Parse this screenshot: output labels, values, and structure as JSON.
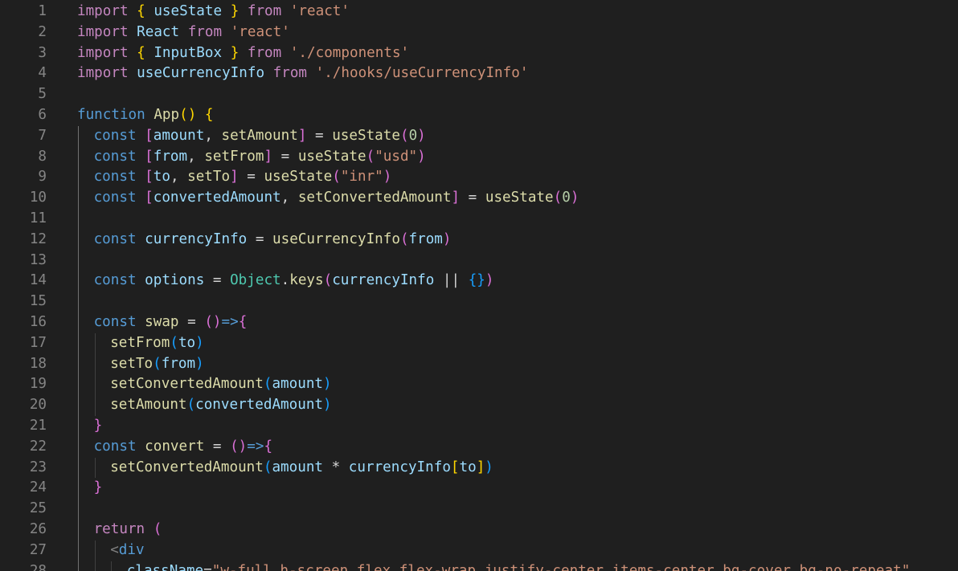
{
  "editor": {
    "lines": [
      {
        "n": "1",
        "indent": 0,
        "tokens": [
          [
            "k",
            "import"
          ],
          [
            "p",
            " "
          ],
          [
            "b1",
            "{"
          ],
          [
            "p",
            " "
          ],
          [
            "v",
            "useState"
          ],
          [
            "p",
            " "
          ],
          [
            "b1",
            "}"
          ],
          [
            "p",
            " "
          ],
          [
            "k",
            "from"
          ],
          [
            "p",
            " "
          ],
          [
            "s",
            "'react'"
          ]
        ]
      },
      {
        "n": "2",
        "indent": 0,
        "tokens": [
          [
            "k",
            "import"
          ],
          [
            "p",
            " "
          ],
          [
            "v",
            "React"
          ],
          [
            "p",
            " "
          ],
          [
            "k",
            "from"
          ],
          [
            "p",
            " "
          ],
          [
            "s",
            "'react'"
          ]
        ]
      },
      {
        "n": "3",
        "indent": 0,
        "tokens": [
          [
            "k",
            "import"
          ],
          [
            "p",
            " "
          ],
          [
            "b1",
            "{"
          ],
          [
            "p",
            " "
          ],
          [
            "v",
            "InputBox"
          ],
          [
            "p",
            " "
          ],
          [
            "b1",
            "}"
          ],
          [
            "p",
            " "
          ],
          [
            "k",
            "from"
          ],
          [
            "p",
            " "
          ],
          [
            "s",
            "'./components'"
          ]
        ]
      },
      {
        "n": "4",
        "indent": 0,
        "tokens": [
          [
            "k",
            "import"
          ],
          [
            "p",
            " "
          ],
          [
            "v",
            "useCurrencyInfo"
          ],
          [
            "p",
            " "
          ],
          [
            "k",
            "from"
          ],
          [
            "p",
            " "
          ],
          [
            "s",
            "'./hooks/useCurrencyInfo'"
          ]
        ]
      },
      {
        "n": "5",
        "indent": 0,
        "tokens": []
      },
      {
        "n": "6",
        "indent": 0,
        "tokens": [
          [
            "st",
            "function"
          ],
          [
            "p",
            " "
          ],
          [
            "f",
            "App"
          ],
          [
            "b1",
            "()"
          ],
          [
            "p",
            " "
          ],
          [
            "b1",
            "{"
          ]
        ]
      },
      {
        "n": "7",
        "indent": 1,
        "tokens": [
          [
            "st",
            "const"
          ],
          [
            "p",
            " "
          ],
          [
            "b2",
            "["
          ],
          [
            "v",
            "amount"
          ],
          [
            "p",
            ", "
          ],
          [
            "f",
            "setAmount"
          ],
          [
            "b2",
            "]"
          ],
          [
            "p",
            " = "
          ],
          [
            "f",
            "useState"
          ],
          [
            "b2",
            "("
          ],
          [
            "n",
            "0"
          ],
          [
            "b2",
            ")"
          ]
        ]
      },
      {
        "n": "8",
        "indent": 1,
        "tokens": [
          [
            "st",
            "const"
          ],
          [
            "p",
            " "
          ],
          [
            "b2",
            "["
          ],
          [
            "v",
            "from"
          ],
          [
            "p",
            ", "
          ],
          [
            "f",
            "setFrom"
          ],
          [
            "b2",
            "]"
          ],
          [
            "p",
            " = "
          ],
          [
            "f",
            "useState"
          ],
          [
            "b2",
            "("
          ],
          [
            "s",
            "\"usd\""
          ],
          [
            "b2",
            ")"
          ]
        ]
      },
      {
        "n": "9",
        "indent": 1,
        "tokens": [
          [
            "st",
            "const"
          ],
          [
            "p",
            " "
          ],
          [
            "b2",
            "["
          ],
          [
            "v",
            "to"
          ],
          [
            "p",
            ", "
          ],
          [
            "f",
            "setTo"
          ],
          [
            "b2",
            "]"
          ],
          [
            "p",
            " = "
          ],
          [
            "f",
            "useState"
          ],
          [
            "b2",
            "("
          ],
          [
            "s",
            "\"inr\""
          ],
          [
            "b2",
            ")"
          ]
        ]
      },
      {
        "n": "10",
        "indent": 1,
        "tokens": [
          [
            "st",
            "const"
          ],
          [
            "p",
            " "
          ],
          [
            "b2",
            "["
          ],
          [
            "v",
            "convertedAmount"
          ],
          [
            "p",
            ", "
          ],
          [
            "f",
            "setConvertedAmount"
          ],
          [
            "b2",
            "]"
          ],
          [
            "p",
            " = "
          ],
          [
            "f",
            "useState"
          ],
          [
            "b2",
            "("
          ],
          [
            "n",
            "0"
          ],
          [
            "b2",
            ")"
          ]
        ]
      },
      {
        "n": "11",
        "indent": 1,
        "tokens": []
      },
      {
        "n": "12",
        "indent": 1,
        "tokens": [
          [
            "st",
            "const"
          ],
          [
            "p",
            " "
          ],
          [
            "v",
            "currencyInfo"
          ],
          [
            "p",
            " = "
          ],
          [
            "f",
            "useCurrencyInfo"
          ],
          [
            "b2",
            "("
          ],
          [
            "v",
            "from"
          ],
          [
            "b2",
            ")"
          ]
        ]
      },
      {
        "n": "13",
        "indent": 1,
        "tokens": []
      },
      {
        "n": "14",
        "indent": 1,
        "tokens": [
          [
            "st",
            "const"
          ],
          [
            "p",
            " "
          ],
          [
            "v",
            "options"
          ],
          [
            "p",
            " = "
          ],
          [
            "cl",
            "Object"
          ],
          [
            "p",
            "."
          ],
          [
            "f",
            "keys"
          ],
          [
            "b2",
            "("
          ],
          [
            "v",
            "currencyInfo"
          ],
          [
            "p",
            " || "
          ],
          [
            "b3",
            "{}"
          ],
          [
            "b2",
            ")"
          ]
        ]
      },
      {
        "n": "15",
        "indent": 1,
        "tokens": []
      },
      {
        "n": "16",
        "indent": 1,
        "tokens": [
          [
            "st",
            "const"
          ],
          [
            "p",
            " "
          ],
          [
            "f",
            "swap"
          ],
          [
            "p",
            " = "
          ],
          [
            "b2",
            "()"
          ],
          [
            "st",
            "=>"
          ],
          [
            "b2",
            "{"
          ]
        ]
      },
      {
        "n": "17",
        "indent": 2,
        "tokens": [
          [
            "f",
            "setFrom"
          ],
          [
            "b3",
            "("
          ],
          [
            "v",
            "to"
          ],
          [
            "b3",
            ")"
          ]
        ]
      },
      {
        "n": "18",
        "indent": 2,
        "tokens": [
          [
            "f",
            "setTo"
          ],
          [
            "b3",
            "("
          ],
          [
            "v",
            "from"
          ],
          [
            "b3",
            ")"
          ]
        ]
      },
      {
        "n": "19",
        "indent": 2,
        "tokens": [
          [
            "f",
            "setConvertedAmount"
          ],
          [
            "b3",
            "("
          ],
          [
            "v",
            "amount"
          ],
          [
            "b3",
            ")"
          ]
        ]
      },
      {
        "n": "20",
        "indent": 2,
        "tokens": [
          [
            "f",
            "setAmount"
          ],
          [
            "b3",
            "("
          ],
          [
            "v",
            "convertedAmount"
          ],
          [
            "b3",
            ")"
          ]
        ]
      },
      {
        "n": "21",
        "indent": 1,
        "tokens": [
          [
            "b2",
            "}"
          ]
        ]
      },
      {
        "n": "22",
        "indent": 1,
        "tokens": [
          [
            "st",
            "const"
          ],
          [
            "p",
            " "
          ],
          [
            "f",
            "convert"
          ],
          [
            "p",
            " = "
          ],
          [
            "b2",
            "()"
          ],
          [
            "st",
            "=>"
          ],
          [
            "b2",
            "{"
          ]
        ]
      },
      {
        "n": "23",
        "indent": 2,
        "tokens": [
          [
            "f",
            "setConvertedAmount"
          ],
          [
            "b3",
            "("
          ],
          [
            "v",
            "amount"
          ],
          [
            "p",
            " * "
          ],
          [
            "v",
            "currencyInfo"
          ],
          [
            "b1",
            "["
          ],
          [
            "v",
            "to"
          ],
          [
            "b1",
            "]"
          ],
          [
            "b3",
            ")"
          ]
        ]
      },
      {
        "n": "24",
        "indent": 1,
        "tokens": [
          [
            "b2",
            "}"
          ]
        ]
      },
      {
        "n": "25",
        "indent": 1,
        "tokens": []
      },
      {
        "n": "26",
        "indent": 1,
        "tokens": [
          [
            "k",
            "return"
          ],
          [
            "p",
            " "
          ],
          [
            "b2",
            "("
          ]
        ]
      },
      {
        "n": "27",
        "indent": 2,
        "tokens": [
          [
            "tag",
            "<"
          ],
          [
            "tn",
            "div"
          ]
        ]
      },
      {
        "n": "28",
        "indent": 3,
        "tokens": [
          [
            "v",
            "className"
          ],
          [
            "p",
            "="
          ],
          [
            "s",
            "\"w-full h-screen flex flex-wrap justify-center items-center bg-cover bg-no-repeat\""
          ]
        ]
      }
    ]
  },
  "colors": {
    "background": "#1f1f1f",
    "line_number": "#858585",
    "indent_guide": "#404040"
  }
}
